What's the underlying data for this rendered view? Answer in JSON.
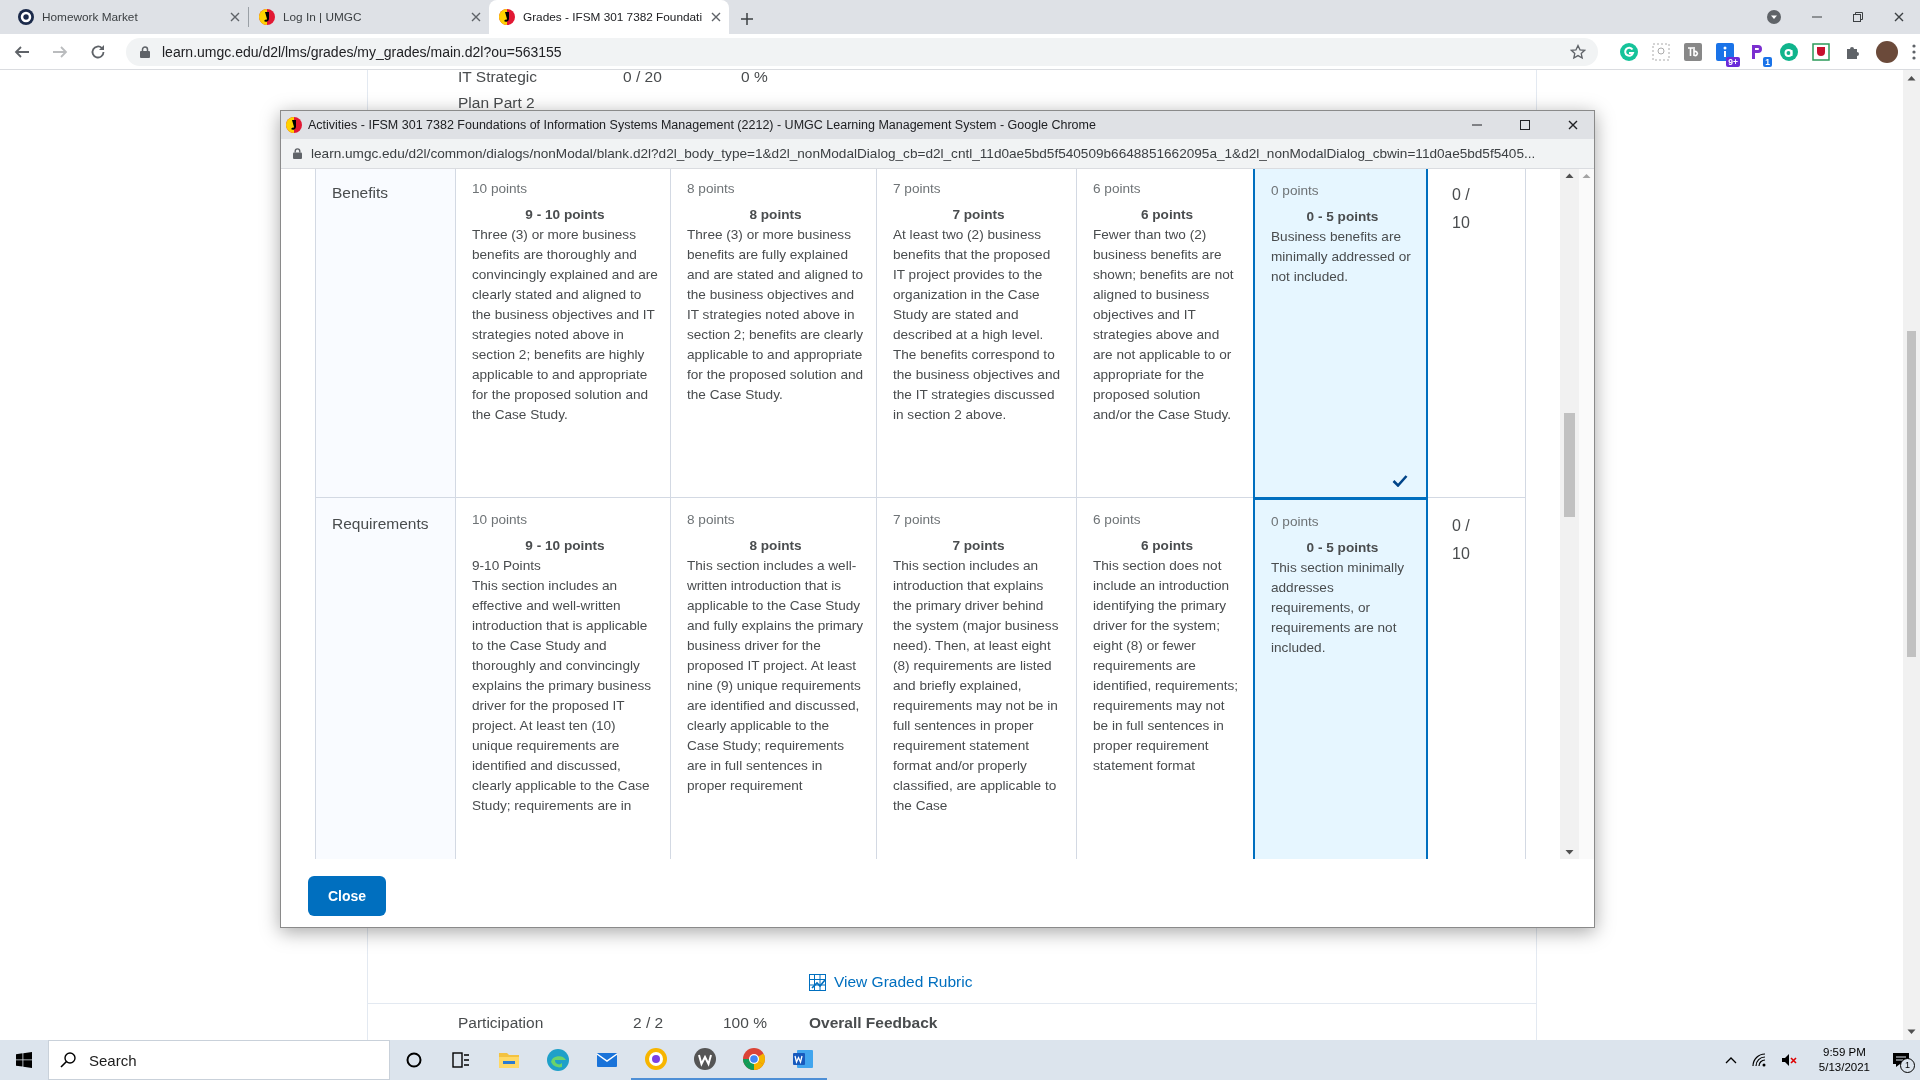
{
  "browser": {
    "tabs": [
      {
        "title": "Homework Market",
        "kind": "ring",
        "selected": false
      },
      {
        "title": "Log In | UMGC",
        "kind": "umgc",
        "selected": false
      },
      {
        "title": "Grades - IFSM 301 7382 Foundati",
        "kind": "umgc",
        "selected": true
      }
    ],
    "url": "learn.umgc.edu/d2l/lms/grades/my_grades/main.d2l?ou=563155",
    "extension_badges": [
      "9+",
      "1"
    ]
  },
  "page": {
    "top_row": {
      "item": "IT Strategic Plan Part 2",
      "score": "0 / 20",
      "percent": "0 %"
    },
    "link": "View Graded Rubric",
    "bottom_row": {
      "item": "Participation",
      "score": "2 / 2",
      "percent": "100 %",
      "feedback_heading": "Overall Feedback"
    }
  },
  "popup": {
    "title": "Activities - IFSM 301 7382 Foundations of Information Systems Management (2212) - UMGC Learning Management System - Google Chrome",
    "url": "learn.umgc.edu/d2l/common/dialogs/nonModal/blank.d2l?d2l_body_type=1&d2l_nonModalDialog_cb=d2l_cntl_11d0ae5bd5f540509b6648851662095a_1&d2l_nonModalDialog_cbwin=11d0ae5bd5f5405...",
    "rubric": {
      "rows": [
        {
          "criterion": "Benefits",
          "score": "0 / 10",
          "levels": [
            {
              "points": "10 points",
              "heading": "9 - 10 points",
              "description": [
                "Three (3) or more business benefits are thoroughly and convincingly explained and are clearly stated and aligned to the business objectives and IT strategies noted above in section 2; benefits are highly applicable to and appropriate for the proposed solution and the Case Study."
              ],
              "selected": false,
              "checked": false
            },
            {
              "points": "8 points",
              "heading": "8 points",
              "description": [
                "Three (3) or more business benefits are fully explained and are stated and aligned to the business objectives and IT strategies noted above in section 2; benefits are clearly applicable to and appropriate for the proposed solution and the Case Study."
              ],
              "selected": false,
              "checked": false
            },
            {
              "points": "7 points",
              "heading": "7 points",
              "description": [
                "At least two (2) business benefits that the proposed IT project provides to the organization in the Case Study are stated and described at a high level. The benefits correspond to the business objectives and the IT strategies discussed in section 2 above."
              ],
              "selected": false,
              "checked": false
            },
            {
              "points": "6 points",
              "heading": "6 points",
              "description": [
                "Fewer than two (2) business benefits are shown; benefits are not aligned to business objectives and IT strategies above and are not applicable to or appropriate for the proposed solution and/or the Case Study."
              ],
              "selected": false,
              "checked": false
            },
            {
              "points": "0 points",
              "heading": "0 - 5 points",
              "description": [
                "Business benefits are minimally addressed or not included."
              ],
              "selected": true,
              "checked": true
            }
          ]
        },
        {
          "criterion": "Requirements",
          "score": "0 / 10",
          "levels": [
            {
              "points": "10 points",
              "heading": "9 - 10 points",
              "description": [
                "9-10 Points",
                "This section includes an effective and well-written introduction that is applicable to the Case Study and thoroughly and convincingly explains the primary business driver for the proposed IT project. At least ten (10) unique requirements are identified and discussed, clearly applicable to the Case Study; requirements are in"
              ],
              "selected": false,
              "checked": false
            },
            {
              "points": "8 points",
              "heading": "8 points",
              "description": [
                "This section includes a well-written introduction that is applicable to the Case Study and fully explains the primary business driver for the proposed IT project. At least nine (9) unique requirements are identified and discussed, clearly applicable to the Case Study; requirements are in full sentences in proper requirement"
              ],
              "selected": false,
              "checked": false
            },
            {
              "points": "7 points",
              "heading": "7 points",
              "description": [
                "This section includes an introduction that explains the primary driver behind the system (major business need). Then, at least eight (8) requirements are listed and briefly explained, requirements may not be in full sentences in proper requirement statement format and/or properly classified, are applicable to the Case"
              ],
              "selected": false,
              "checked": false
            },
            {
              "points": "6 points",
              "heading": "6 points",
              "description": [
                "This section does not include an introduction identifying the primary driver for the system; eight (8) or fewer requirements are identified, requirements; requirements may not be in full sentences in proper requirement statement format"
              ],
              "selected": false,
              "checked": false
            },
            {
              "points": "0 points",
              "heading": "0 - 5 points",
              "description": [
                "This section minimally addresses requirements, or requirements are not included."
              ],
              "selected": true,
              "checked": false
            }
          ]
        }
      ]
    },
    "close_button": "Close"
  },
  "taskbar": {
    "search": {
      "placeholder": "Search"
    },
    "apps": [
      {
        "kind": "folder",
        "running": false
      },
      {
        "kind": "edge",
        "running": false
      },
      {
        "kind": "mail",
        "running": false
      },
      {
        "kind": "ring-browser",
        "running": true
      },
      {
        "kind": "w-app",
        "running": true
      },
      {
        "kind": "chrome",
        "running": true
      },
      {
        "kind": "word",
        "running": true
      }
    ],
    "time": "9:59 PM",
    "date": "5/13/2021",
    "notification_count": "1"
  }
}
